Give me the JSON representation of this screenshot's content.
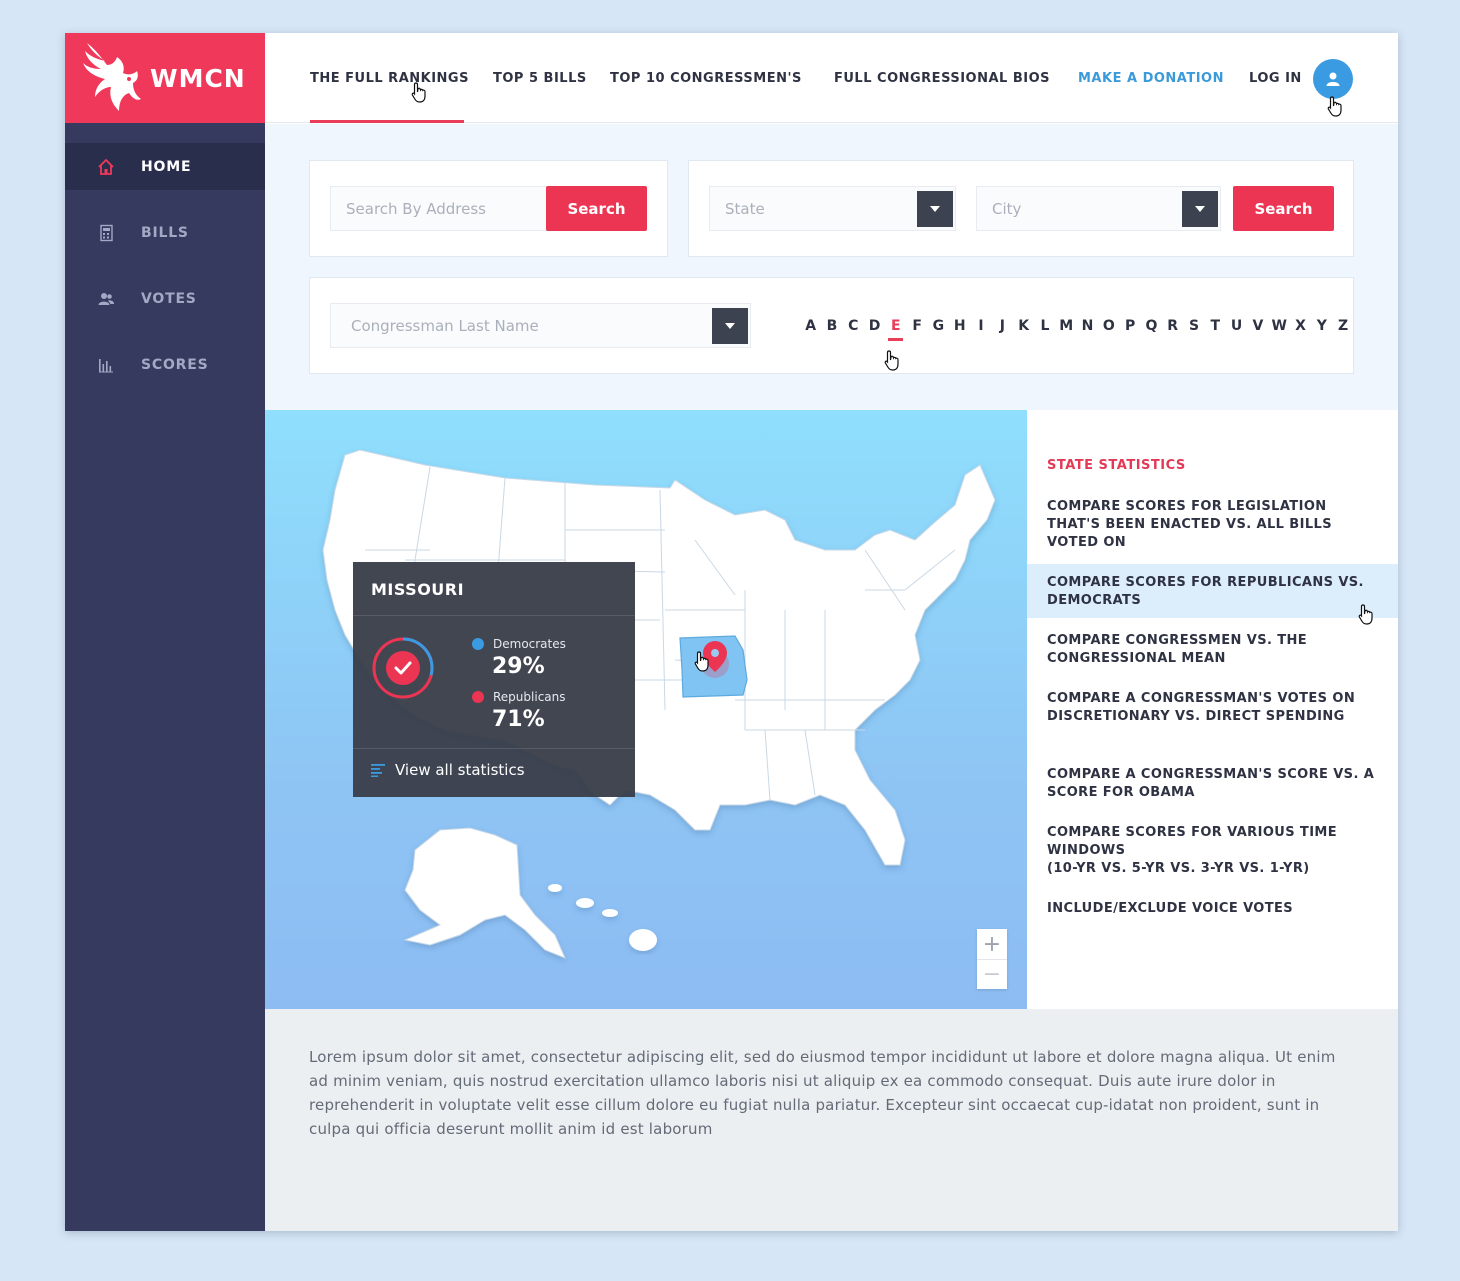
{
  "brand": {
    "name": "WMCN",
    "color": "#f0385a"
  },
  "sidebar": {
    "items": [
      {
        "label": "HOME",
        "icon": "home-icon",
        "active": true
      },
      {
        "label": "BILLS",
        "icon": "calculator-icon",
        "active": false
      },
      {
        "label": "VOTES",
        "icon": "users-icon",
        "active": false
      },
      {
        "label": "SCORES",
        "icon": "bar-chart-icon",
        "active": false
      }
    ]
  },
  "topnav": {
    "links": [
      "THE FULL RANKINGS",
      "TOP 5 BILLS",
      "TOP 10 CONGRESSMEN'S",
      "FULL CONGRESSIONAL BIOS"
    ],
    "donate": "MAKE A DONATION",
    "login": "LOG IN",
    "active_tab": "THE FULL RANKINGS"
  },
  "search": {
    "address_placeholder": "Search By Address",
    "address_button": "Search",
    "state_placeholder": "State",
    "city_placeholder": "City",
    "location_button": "Search",
    "lastname_placeholder": "Congressman Last Name",
    "alphabet": [
      "A",
      "B",
      "C",
      "D",
      "E",
      "F",
      "G",
      "H",
      "I",
      "J",
      "K",
      "L",
      "M",
      "N",
      "O",
      "P",
      "Q",
      "R",
      "S",
      "T",
      "U",
      "V",
      "W",
      "X",
      "Y",
      "Z"
    ],
    "selected_letter": "E"
  },
  "map": {
    "tooltip": {
      "state": "MISSOURI",
      "democrats_label": "Democrates",
      "democrats_value": "29%",
      "democrats_fraction": 0.29,
      "democrats_color": "#3a9be2",
      "republicans_label": "Republicans",
      "republicans_value": "71%",
      "republicans_color": "#ec3453",
      "view_all": "View all statistics"
    },
    "zoom_in": "+",
    "zoom_out": "−"
  },
  "stats": {
    "title": "STATE STATISTICS",
    "items": [
      "COMPARE SCORES FOR LEGISLATION THAT'S BEEN ENACTED VS. ALL BILLS VOTED ON",
      "COMPARE SCORES FOR REPUBLICANS VS. DEMOCRATS",
      "COMPARE CONGRESSMEN VS. THE CONGRESSIONAL MEAN",
      "COMPARE A CONGRESSMAN'S VOTES ON DISCRETIONARY VS. DIRECT SPENDING",
      "COMPARE A CONGRESSMAN'S SCORE VS. A SCORE FOR OBAMA",
      "COMPARE SCORES FOR VARIOUS TIME WINDOWS",
      "(10-YR VS. 5-YR VS. 3-YR VS. 1-YR)",
      "INCLUDE/EXCLUDE VOICE VOTES"
    ],
    "highlighted_index": 1
  },
  "footer": {
    "text": "Lorem ipsum dolor sit amet, consectetur adipiscing elit, sed do eiusmod tempor incididunt ut labore et dolore magna aliqua. Ut enim ad minim veniam, quis nostrud exercitation ullamco laboris nisi ut aliquip ex ea commodo consequat. Duis aute irure dolor in reprehenderit in voluptate velit esse cillum dolore eu fugiat nulla pariatur. Excepteur sint occaecat cup-idatat non proident, sunt in culpa qui officia deserunt mollit anim id est laborum"
  }
}
